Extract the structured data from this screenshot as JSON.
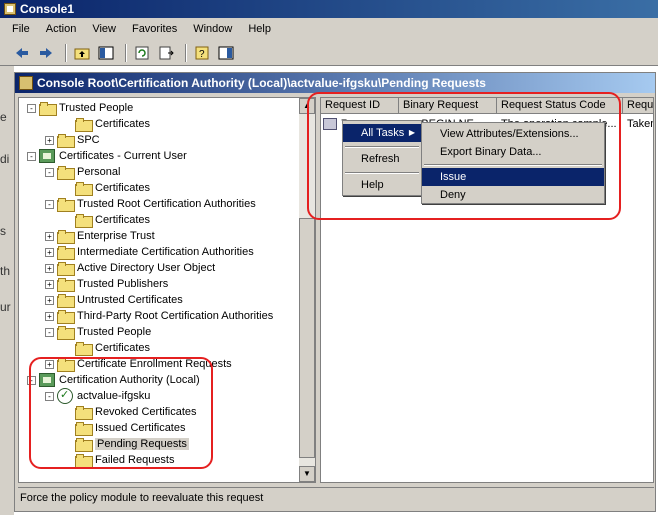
{
  "window": {
    "title": "Console1"
  },
  "menu": [
    "File",
    "Action",
    "View",
    "Favorites",
    "Window",
    "Help"
  ],
  "toolbar": {
    "buttons": [
      "back-arrow-icon",
      "forward-arrow-icon",
      "up-folder-icon",
      "show-hide-tree-icon",
      "refresh-icon",
      "export-list-icon",
      "help-icon",
      "show-hide-action-pane-icon"
    ]
  },
  "background_window_letters": [
    "e",
    "di",
    "s",
    "th",
    "ur"
  ],
  "child_window": {
    "path": "Console Root\\Certification Authority (Local)\\actvalue-ifgsku\\Pending Requests"
  },
  "tree": {
    "items": [
      {
        "label": "Trusted People",
        "icon": "folder-icon",
        "expander": "-"
      },
      {
        "label": "Certificates",
        "icon": "folder-icon",
        "expander": ""
      },
      {
        "label": "SPC",
        "icon": "folder-icon",
        "expander": "+"
      },
      {
        "label": "Certificates - Current User",
        "icon": "cert-store-icon",
        "expander": "-"
      },
      {
        "label": "Personal",
        "icon": "folder-icon",
        "expander": "-"
      },
      {
        "label": "Certificates",
        "icon": "folder-icon",
        "expander": ""
      },
      {
        "label": "Trusted Root Certification Authorities",
        "icon": "folder-icon",
        "expander": "-"
      },
      {
        "label": "Certificates",
        "icon": "folder-icon",
        "expander": ""
      },
      {
        "label": "Enterprise Trust",
        "icon": "folder-icon",
        "expander": "+"
      },
      {
        "label": "Intermediate Certification Authorities",
        "icon": "folder-icon",
        "expander": "+"
      },
      {
        "label": "Active Directory User Object",
        "icon": "folder-icon",
        "expander": "+"
      },
      {
        "label": "Trusted Publishers",
        "icon": "folder-icon",
        "expander": "+"
      },
      {
        "label": "Untrusted Certificates",
        "icon": "folder-icon",
        "expander": "+"
      },
      {
        "label": "Third-Party Root Certification Authorities",
        "icon": "folder-icon",
        "expander": "+"
      },
      {
        "label": "Trusted People",
        "icon": "folder-icon",
        "expander": "-"
      },
      {
        "label": "Certificates",
        "icon": "folder-icon",
        "expander": ""
      },
      {
        "label": "Certificate Enrollment Requests",
        "icon": "folder-icon",
        "expander": "+"
      },
      {
        "label": "Certification Authority (Local)",
        "icon": "cert-store-icon",
        "expander": "-"
      },
      {
        "label": "actvalue-ifgsku",
        "icon": "ca-server-icon",
        "expander": "-"
      },
      {
        "label": "Revoked Certificates",
        "icon": "folder-icon",
        "expander": ""
      },
      {
        "label": "Issued Certificates",
        "icon": "folder-icon",
        "expander": ""
      },
      {
        "label": "Pending Requests",
        "icon": "folder-icon",
        "expander": "",
        "selected": true
      },
      {
        "label": "Failed Requests",
        "icon": "folder-icon",
        "expander": ""
      }
    ]
  },
  "list": {
    "columns": [
      "Request ID",
      "Binary Request",
      "Request Status Code",
      "Requ"
    ],
    "rows": [
      {
        "id": "7",
        "binary": "-----BEGIN NE...",
        "status": "The operation comple...",
        "requ": "Taken"
      }
    ]
  },
  "context_menu": {
    "items": [
      "All Tasks",
      "Refresh",
      "Help"
    ]
  },
  "submenu": {
    "items": [
      "View Attributes/Extensions...",
      "Export Binary Data...",
      "Issue",
      "Deny"
    ],
    "highlighted": "Issue"
  },
  "annotation_color": "#e52020",
  "status_bar": {
    "text": "Force the policy module to reevaluate this request"
  }
}
